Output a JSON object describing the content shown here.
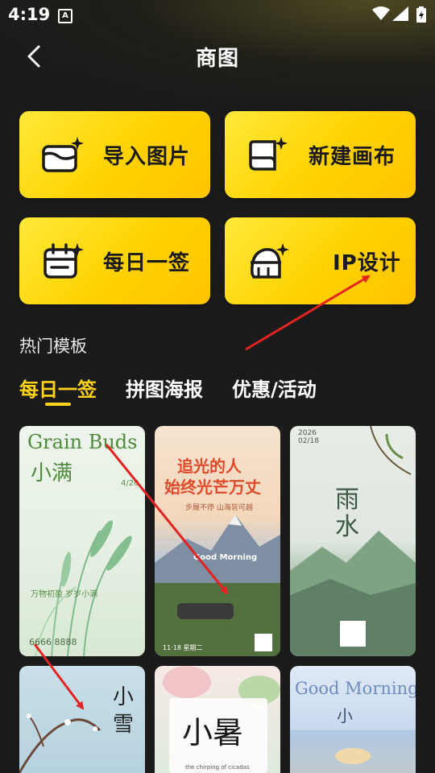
{
  "status": {
    "time": "4:19",
    "notif_icon": "A"
  },
  "header": {
    "title": "商图"
  },
  "tools": [
    {
      "label": "导入图片",
      "icon": "import-image-icon"
    },
    {
      "label": "新建画布",
      "icon": "new-canvas-icon"
    },
    {
      "label": "每日一签",
      "icon": "daily-sign-icon"
    },
    {
      "label": "IP设计",
      "icon": "ip-design-icon"
    }
  ],
  "section": {
    "title": "热门模板"
  },
  "tabs": [
    {
      "label": "每日一签",
      "active": true
    },
    {
      "label": "拼图海报",
      "active": false
    },
    {
      "label": "优惠/活动",
      "active": false
    }
  ],
  "templates": [
    {
      "title_en": "Grain Buds",
      "title_cn": "小满",
      "date": "4/20",
      "lines": "万物初盈 岁岁小满",
      "footer": "6666 8888"
    },
    {
      "title_cn": "追光的人",
      "title_cn2": "始终光芒万丈",
      "subtitle": "步履不停 山海皆可越",
      "greeting": "Good Morning",
      "date": "11·18 星期二"
    },
    {
      "year": "2026",
      "date": "02/18",
      "title_cn": "雨",
      "title_cn2": "水"
    },
    {
      "title_cn": "小",
      "title_cn2": "雪"
    },
    {
      "title_cn": "小暑",
      "tagline": "the chirping of cicadas"
    },
    {
      "title_en": "Good Morning",
      "title_cn": "小"
    }
  ],
  "colors": {
    "accent": "#ffd21a",
    "card": "#ffd200",
    "background": "#1b1b1b",
    "arrow": "#e32222"
  }
}
